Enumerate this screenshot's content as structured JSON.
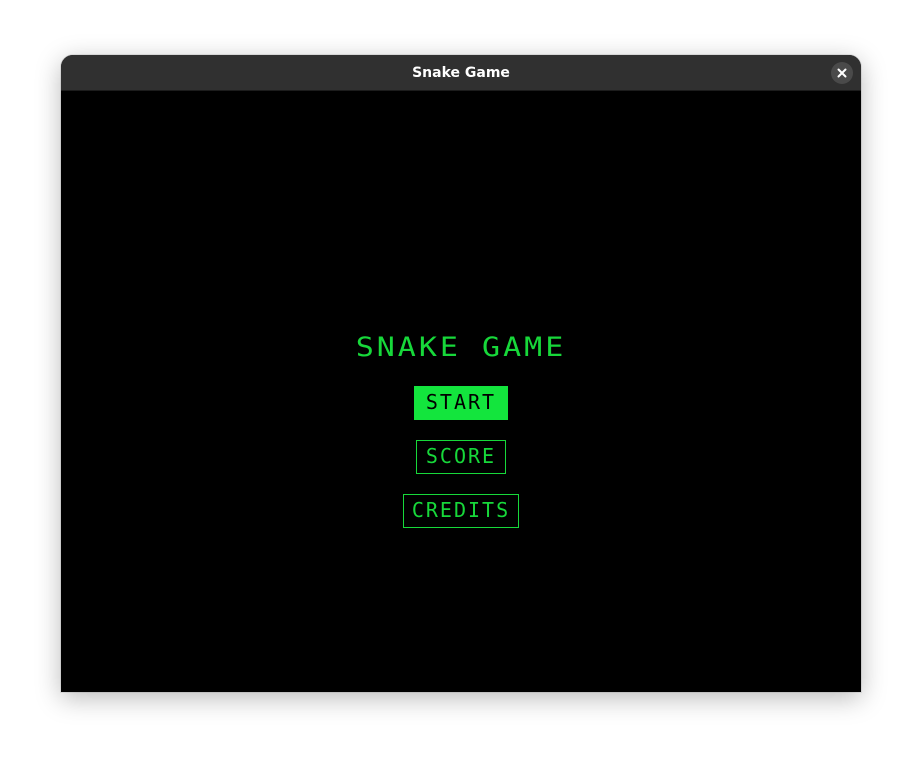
{
  "window": {
    "title": "Snake Game"
  },
  "game": {
    "title": "SNAKE GAME",
    "menu": {
      "start_label": "START",
      "score_label": "SCORE",
      "credits_label": "CREDITS",
      "selected": "START"
    }
  },
  "colors": {
    "accent": "#17d83a",
    "selected_bg": "#13e53d",
    "background": "#000000",
    "titlebar": "#303030"
  },
  "icons": {
    "close": "close-icon"
  }
}
